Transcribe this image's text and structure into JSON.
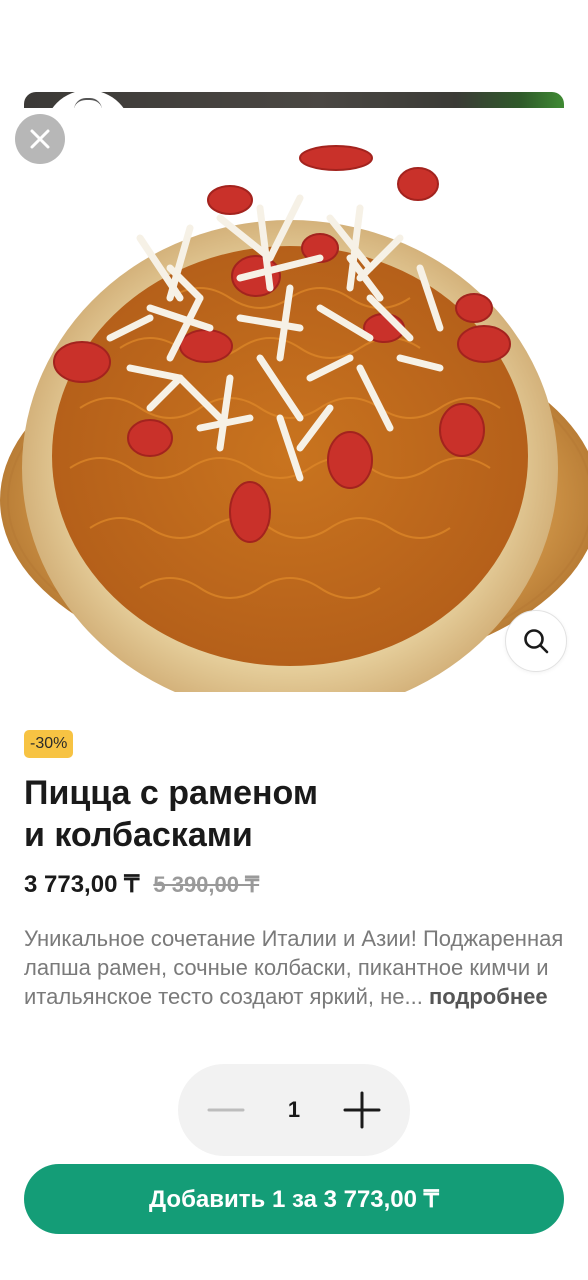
{
  "background": {
    "logo_icon": "cat-logo-icon"
  },
  "product": {
    "image_alt": "pizza-photo",
    "discount": "-30%",
    "title_line1": "Пицца с раменом",
    "title_line2": "и колбасками",
    "price_current": "3 773,00 ₸",
    "price_old": "5 390,00 ₸",
    "description": "Уникальное сочетание Италии и Азии! Поджаренная лапша рамен, сочные колбаски, пикантное кимчи и итальянское тесто создают яркий, не...",
    "more_label": "подробнее"
  },
  "controls": {
    "close_icon": "close-icon",
    "zoom_icon": "zoom-icon",
    "quantity": "1",
    "minus_icon": "minus-icon",
    "plus_icon": "plus-icon"
  },
  "cart": {
    "add_label": "Добавить 1 за 3 773,00 ₸"
  },
  "colors": {
    "accent": "#149d77",
    "badge": "#f7c343",
    "text": "#1a1a1a",
    "muted": "#7a7a7a"
  }
}
